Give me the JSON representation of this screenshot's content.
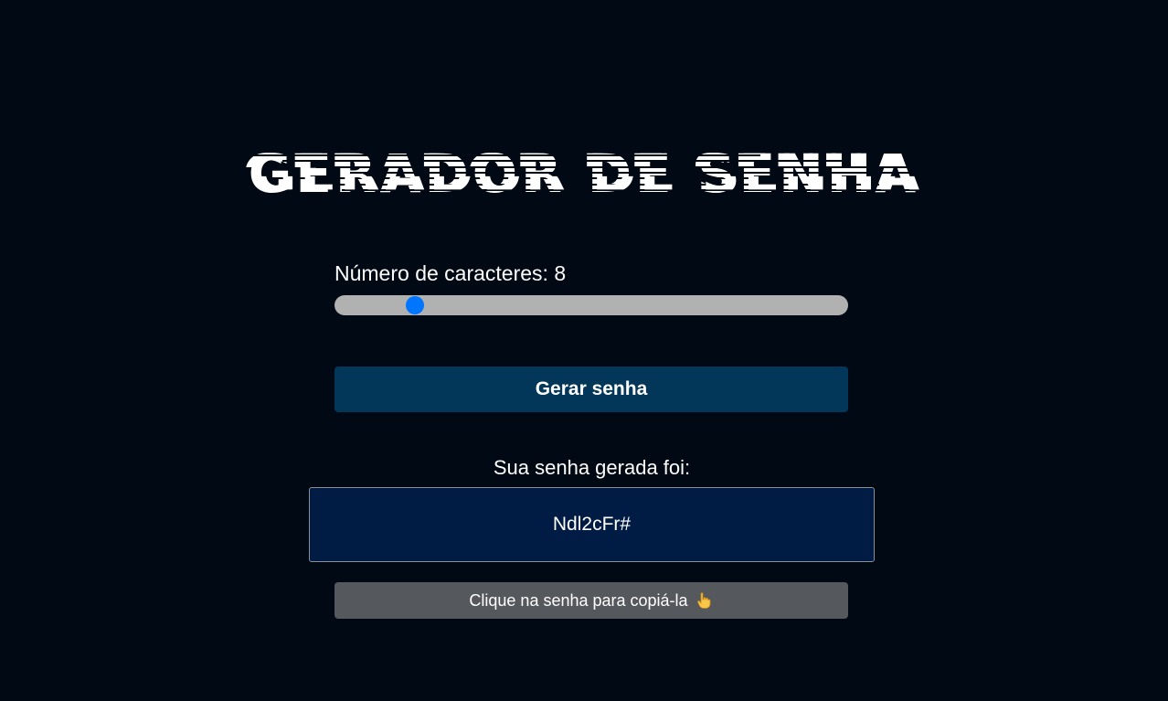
{
  "title": "GERADOR DE SENHA",
  "slider": {
    "label_prefix": "Número de caracteres: ",
    "value": 8,
    "label": "Número de caracteres: 8",
    "min": 4,
    "max": 32,
    "accent": "#0075ff",
    "track_color": "#b1b1b1"
  },
  "generate_button": {
    "label": "Gerar senha",
    "color": "#02375a"
  },
  "result": {
    "label": "Sua senha gerada foi:",
    "password": "Ndl2cFr#"
  },
  "copy_hint": {
    "label": "Clique na senha para copiá-la",
    "icon": "pointing-hand-icon"
  },
  "colors": {
    "background": "#010914",
    "password_box": "#001c44",
    "hint_background": "#55585c"
  }
}
